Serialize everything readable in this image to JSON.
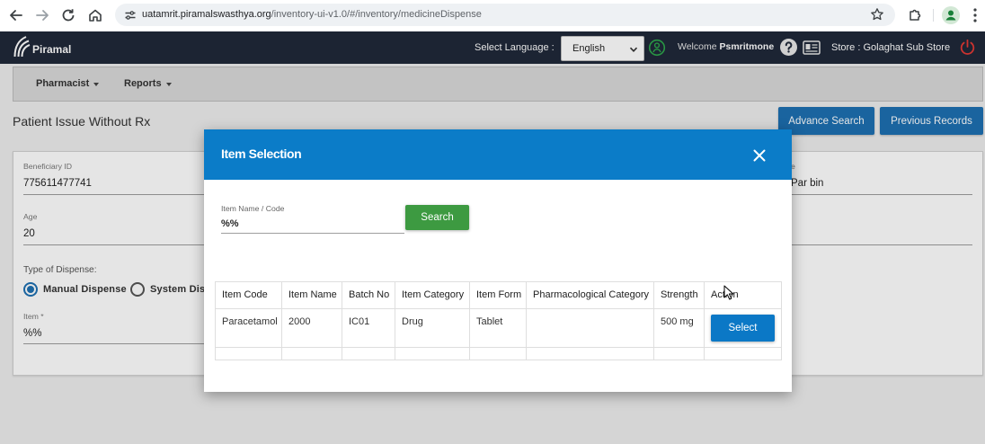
{
  "browser": {
    "url_host": "uatamrit.piramalswasthya.org",
    "url_path": "/inventory-ui-v1.0/#/inventory/medicineDispense",
    "icons": {
      "back": "arrow-left-icon",
      "forward": "arrow-right-icon",
      "reload": "reload-icon",
      "home": "home-icon",
      "site_info": "tune-icon",
      "bookmark": "star-icon",
      "extensions": "puzzle-icon",
      "profile": "profile-icon",
      "menu": "more-vertical-icon"
    }
  },
  "header": {
    "brand": "Piramal",
    "language_label": "Select Language :",
    "language_value": "English",
    "welcome_label": "Welcome",
    "username": "Psmritmone",
    "store": "Store : Golaghat Sub Store",
    "icons": {
      "logo": "piramal-logo-icon",
      "language_dropdown": "chevron-down-icon",
      "status": "user-status-icon",
      "help": "help-icon",
      "store_card": "id-card-icon",
      "logout": "power-icon"
    }
  },
  "nav": {
    "items": [
      {
        "label": "Pharmacist"
      },
      {
        "label": "Reports"
      }
    ]
  },
  "page": {
    "title": "Patient Issue Without Rx",
    "advance_search_label": "Advance Search",
    "previous_records_label": "Previous Records",
    "form": {
      "beneficiary_id_label": "Beneficiary ID",
      "beneficiary_id_value": "775611477741",
      "age_label": "Age",
      "age_value": "20",
      "dispense_type_label": "Type of Dispense:",
      "dispense_options": [
        {
          "label": "Manual Dispense",
          "selected": true
        },
        {
          "label": "System Dis",
          "selected": false
        }
      ],
      "item_label": "Item *",
      "item_value": "%%",
      "right_field_label": "e",
      "right_field_value": "Par bin"
    }
  },
  "modal": {
    "title": "Item Selection",
    "search_label": "Item Name / Code",
    "search_value": "%%",
    "search_button": "Search",
    "close_icon": "close-icon",
    "table": {
      "columns": [
        "Item Code",
        "Item Name",
        "Batch No",
        "Item Category",
        "Item Form",
        "Pharmacological Category",
        "Strength",
        "Action"
      ],
      "rows": [
        {
          "item_code": "Paracetamol",
          "item_name": "2000",
          "batch_no": "IC01",
          "item_category": "Drug",
          "item_form": "Tablet",
          "pharmacological_category": "",
          "strength": "500 mg",
          "action": "Select"
        }
      ]
    }
  },
  "colors": {
    "app_header": "#202939",
    "modal_header": "#0b7cc8",
    "primary_button": "#0b78c6",
    "page_button": "#1d70b2",
    "search_button": "#3d9a41",
    "status_icon": "#2ea84c",
    "power_icon": "#e53935"
  }
}
